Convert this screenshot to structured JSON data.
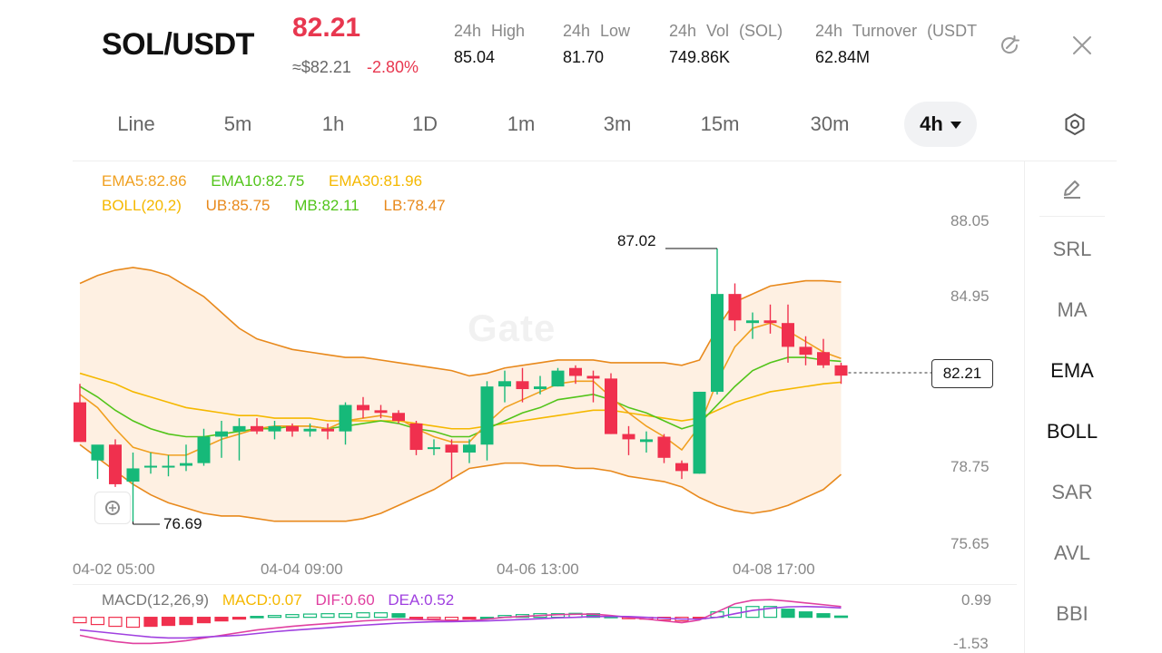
{
  "header": {
    "pair": "SOL/USDT",
    "price": "82.21",
    "approx_price": "≈$82.21",
    "change": "-2.80%",
    "stats": [
      {
        "label": "24h High",
        "value": "85.04"
      },
      {
        "label": "24h Low",
        "value": "81.70"
      },
      {
        "label": "24h Vol (SOL)",
        "value": "749.86K"
      },
      {
        "label": "24h Turnover (USDT",
        "value": "62.84M"
      }
    ],
    "icons": [
      "refresh-icon",
      "close-icon"
    ]
  },
  "timeframes": [
    "Line",
    "5m",
    "1h",
    "1D",
    "1m",
    "3m",
    "15m",
    "30m",
    "4h"
  ],
  "active_timeframe": "4h",
  "side_tools": [
    "SRL",
    "MA",
    "EMA",
    "BOLL",
    "SAR",
    "AVL",
    "BBI"
  ],
  "active_side_tools": [
    "EMA",
    "BOLL"
  ],
  "legend": {
    "ema5": "EMA5:82.86",
    "ema10": "EMA10:82.75",
    "ema30": "EMA30:81.96",
    "boll": "BOLL(20,2)",
    "ub": "UB:85.75",
    "mb": "MB:82.11",
    "lb": "LB:78.47",
    "macd_title": "MACD(12,26,9)",
    "macd": "MACD:0.07",
    "dif": "DIF:0.60",
    "dea": "DEA:0.52"
  },
  "watermark": "Gate",
  "current_price_tag": "82.21",
  "high_callout": "87.02",
  "low_callout": "76.69",
  "colors": {
    "up": "#16b979",
    "down": "#f0304e",
    "ema5": "#f0a020",
    "ema10": "#52c41a",
    "ema30": "#f5b800",
    "boll_band": "#e8891c",
    "dif": "#e040a0",
    "dea": "#a040e0"
  },
  "chart_data": {
    "type": "candlestick",
    "title": "",
    "y_ticks": [
      "88.05",
      "84.95",
      "78.75",
      "75.65"
    ],
    "x_ticks": [
      "04-02 05:00",
      "04-04 09:00",
      "04-06 13:00",
      "04-08 17:00"
    ],
    "macd_ticks": [
      "0.99",
      "-1.53"
    ],
    "candles": [
      {
        "o": 81.2,
        "h": 81.9,
        "l": 80.0,
        "c": 79.7
      },
      {
        "o": 79.0,
        "h": 79.2,
        "l": 78.3,
        "c": 79.6
      },
      {
        "o": 79.6,
        "h": 79.8,
        "l": 78.0,
        "c": 78.1
      },
      {
        "o": 78.2,
        "h": 79.3,
        "l": 76.69,
        "c": 78.7
      },
      {
        "o": 78.8,
        "h": 79.3,
        "l": 78.5,
        "c": 78.8
      },
      {
        "o": 78.8,
        "h": 79.2,
        "l": 78.4,
        "c": 78.8
      },
      {
        "o": 78.8,
        "h": 79.6,
        "l": 78.6,
        "c": 78.9
      },
      {
        "o": 78.9,
        "h": 80.2,
        "l": 78.8,
        "c": 79.9
      },
      {
        "o": 79.9,
        "h": 80.5,
        "l": 79.1,
        "c": 80.1
      },
      {
        "o": 80.1,
        "h": 80.6,
        "l": 79.0,
        "c": 80.3
      },
      {
        "o": 80.3,
        "h": 80.6,
        "l": 80.0,
        "c": 80.1
      },
      {
        "o": 80.1,
        "h": 80.5,
        "l": 79.8,
        "c": 80.3
      },
      {
        "o": 80.3,
        "h": 80.4,
        "l": 79.9,
        "c": 80.1
      },
      {
        "o": 80.1,
        "h": 80.4,
        "l": 79.9,
        "c": 80.2
      },
      {
        "o": 80.2,
        "h": 80.4,
        "l": 79.8,
        "c": 80.1
      },
      {
        "o": 80.1,
        "h": 81.2,
        "l": 79.6,
        "c": 81.1
      },
      {
        "o": 81.1,
        "h": 81.4,
        "l": 80.6,
        "c": 80.9
      },
      {
        "o": 80.9,
        "h": 81.1,
        "l": 80.6,
        "c": 80.8
      },
      {
        "o": 80.8,
        "h": 80.9,
        "l": 80.4,
        "c": 80.5
      },
      {
        "o": 80.4,
        "h": 80.5,
        "l": 79.2,
        "c": 79.4
      },
      {
        "o": 79.5,
        "h": 79.8,
        "l": 79.2,
        "c": 79.5
      },
      {
        "o": 79.6,
        "h": 79.8,
        "l": 78.3,
        "c": 79.3
      },
      {
        "o": 79.3,
        "h": 79.8,
        "l": 78.9,
        "c": 79.6
      },
      {
        "o": 79.6,
        "h": 82.0,
        "l": 79.0,
        "c": 81.8
      },
      {
        "o": 81.8,
        "h": 82.4,
        "l": 81.2,
        "c": 82.0
      },
      {
        "o": 82.0,
        "h": 82.5,
        "l": 81.2,
        "c": 81.7
      },
      {
        "o": 81.7,
        "h": 82.2,
        "l": 81.5,
        "c": 81.8
      },
      {
        "o": 81.8,
        "h": 82.5,
        "l": 81.8,
        "c": 82.4
      },
      {
        "o": 82.5,
        "h": 82.6,
        "l": 81.9,
        "c": 82.2
      },
      {
        "o": 82.2,
        "h": 82.4,
        "l": 81.2,
        "c": 82.1
      },
      {
        "o": 82.1,
        "h": 82.3,
        "l": 80.0,
        "c": 80.0
      },
      {
        "o": 80.0,
        "h": 80.3,
        "l": 79.2,
        "c": 79.8
      },
      {
        "o": 79.7,
        "h": 80.1,
        "l": 79.3,
        "c": 79.8
      },
      {
        "o": 79.9,
        "h": 80.0,
        "l": 78.9,
        "c": 79.1
      },
      {
        "o": 78.9,
        "h": 79.0,
        "l": 78.3,
        "c": 78.6
      },
      {
        "o": 78.5,
        "h": 81.6,
        "l": 78.5,
        "c": 81.6
      },
      {
        "o": 81.6,
        "h": 87.02,
        "l": 81.5,
        "c": 85.3
      },
      {
        "o": 85.3,
        "h": 85.7,
        "l": 83.9,
        "c": 84.3
      },
      {
        "o": 84.2,
        "h": 84.6,
        "l": 83.6,
        "c": 84.3
      },
      {
        "o": 84.3,
        "h": 84.9,
        "l": 83.8,
        "c": 84.2
      },
      {
        "o": 84.2,
        "h": 84.9,
        "l": 82.7,
        "c": 83.3
      },
      {
        "o": 83.3,
        "h": 83.7,
        "l": 82.6,
        "c": 83.0
      },
      {
        "o": 83.1,
        "h": 83.6,
        "l": 82.5,
        "c": 82.6
      },
      {
        "o": 82.6,
        "h": 82.7,
        "l": 81.9,
        "c": 82.21
      }
    ],
    "ema5": [
      81.5,
      81.0,
      80.2,
      79.5,
      79.3,
      79.2,
      79.2,
      79.5,
      79.8,
      80.0,
      80.2,
      80.3,
      80.3,
      80.3,
      80.2,
      80.5,
      80.6,
      80.7,
      80.6,
      80.2,
      79.9,
      79.7,
      79.7,
      80.4,
      81.0,
      81.3,
      81.6,
      81.9,
      82.0,
      82.0,
      81.4,
      80.8,
      80.3,
      79.9,
      79.4,
      80.3,
      82.0,
      83.3,
      84.0,
      84.2,
      83.9,
      83.5,
      83.1,
      82.86
    ],
    "ema10": [
      81.8,
      81.4,
      80.9,
      80.5,
      80.2,
      80.0,
      79.9,
      79.9,
      80.0,
      80.1,
      80.2,
      80.2,
      80.3,
      80.3,
      80.2,
      80.3,
      80.4,
      80.5,
      80.4,
      80.2,
      80.1,
      79.9,
      79.9,
      80.2,
      80.5,
      80.8,
      81.0,
      81.3,
      81.4,
      81.5,
      81.3,
      81.0,
      80.8,
      80.5,
      80.2,
      80.4,
      81.1,
      81.8,
      82.4,
      82.7,
      82.9,
      82.9,
      82.8,
      82.75
    ],
    "ema30": [
      82.3,
      82.1,
      81.9,
      81.6,
      81.4,
      81.2,
      81.0,
      80.9,
      80.8,
      80.7,
      80.7,
      80.6,
      80.6,
      80.6,
      80.5,
      80.5,
      80.5,
      80.5,
      80.5,
      80.4,
      80.3,
      80.2,
      80.2,
      80.3,
      80.4,
      80.5,
      80.6,
      80.7,
      80.8,
      80.9,
      80.9,
      80.8,
      80.7,
      80.6,
      80.5,
      80.6,
      80.9,
      81.2,
      81.4,
      81.6,
      81.7,
      81.8,
      81.9,
      81.96
    ],
    "boll_ub": [
      85.7,
      86.0,
      86.2,
      86.3,
      86.2,
      86.0,
      85.6,
      85.2,
      84.6,
      84.0,
      83.6,
      83.4,
      83.2,
      83.1,
      83.0,
      82.9,
      82.9,
      82.8,
      82.7,
      82.6,
      82.5,
      82.4,
      82.2,
      82.3,
      82.5,
      82.6,
      82.7,
      82.8,
      82.8,
      82.8,
      82.7,
      82.7,
      82.7,
      82.7,
      82.6,
      82.8,
      84.0,
      85.0,
      85.3,
      85.6,
      85.7,
      85.8,
      85.8,
      85.75
    ],
    "boll_lb": [
      79.6,
      79.1,
      78.6,
      78.1,
      77.7,
      77.4,
      77.2,
      77.0,
      76.9,
      76.9,
      76.8,
      76.7,
      76.7,
      76.7,
      76.7,
      76.7,
      76.8,
      77.0,
      77.3,
      77.6,
      77.9,
      78.3,
      78.7,
      78.8,
      78.9,
      78.9,
      78.8,
      78.8,
      78.7,
      78.7,
      78.6,
      78.4,
      78.3,
      78.2,
      78.0,
      77.6,
      77.3,
      77.1,
      77.0,
      77.1,
      77.3,
      77.6,
      77.9,
      78.47
    ],
    "macd_hist": [
      -0.3,
      -0.4,
      -0.5,
      -0.55,
      -0.5,
      -0.45,
      -0.4,
      -0.3,
      -0.2,
      -0.1,
      0.05,
      0.1,
      0.15,
      0.18,
      0.2,
      0.2,
      0.25,
      0.25,
      0.2,
      -0.05,
      -0.1,
      -0.15,
      -0.1,
      0.0,
      0.1,
      0.15,
      0.2,
      0.2,
      0.22,
      0.2,
      0.05,
      -0.05,
      -0.1,
      -0.15,
      -0.2,
      -0.05,
      0.3,
      0.55,
      0.6,
      0.6,
      0.45,
      0.3,
      0.2,
      0.07
    ],
    "dif": [
      -1.0,
      -1.2,
      -1.35,
      -1.45,
      -1.45,
      -1.4,
      -1.3,
      -1.15,
      -1.0,
      -0.85,
      -0.7,
      -0.6,
      -0.5,
      -0.42,
      -0.35,
      -0.28,
      -0.2,
      -0.15,
      -0.1,
      -0.12,
      -0.15,
      -0.2,
      -0.2,
      -0.1,
      0.0,
      0.05,
      0.1,
      0.15,
      0.17,
      0.18,
      0.1,
      0.0,
      -0.1,
      -0.2,
      -0.3,
      -0.15,
      0.3,
      0.75,
      0.95,
      0.98,
      0.9,
      0.8,
      0.7,
      0.6
    ],
    "dea": [
      -0.7,
      -0.8,
      -0.9,
      -1.0,
      -1.1,
      -1.15,
      -1.15,
      -1.1,
      -1.05,
      -1.0,
      -0.9,
      -0.8,
      -0.72,
      -0.65,
      -0.58,
      -0.5,
      -0.44,
      -0.38,
      -0.32,
      -0.28,
      -0.25,
      -0.24,
      -0.22,
      -0.2,
      -0.16,
      -0.12,
      -0.08,
      -0.03,
      0.0,
      0.04,
      0.05,
      0.04,
      0.0,
      -0.05,
      -0.1,
      -0.1,
      0.0,
      0.2,
      0.38,
      0.5,
      0.58,
      0.6,
      0.57,
      0.52
    ]
  }
}
